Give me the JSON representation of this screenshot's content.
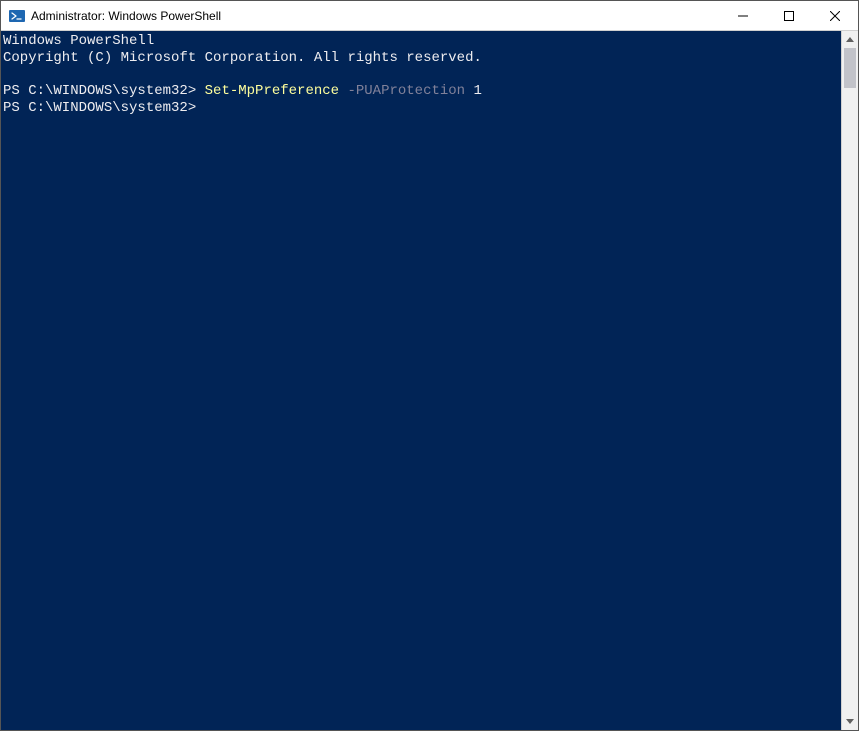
{
  "window": {
    "title": "Administrator: Windows PowerShell"
  },
  "terminal": {
    "header_line1": "Windows PowerShell",
    "header_line2": "Copyright (C) Microsoft Corporation. All rights reserved.",
    "prompt1_prefix": "PS C:\\WINDOWS\\system32> ",
    "prompt1_cmdlet": "Set-MpPreference",
    "prompt1_param": " -PUAProtection",
    "prompt1_value": " 1",
    "prompt2_prefix": "PS C:\\WINDOWS\\system32>"
  },
  "colors": {
    "terminal_bg": "#012456",
    "text_default": "#cccccc",
    "text_white": "#eeedf0",
    "text_yellow": "#fefe9c",
    "text_gray": "#818199"
  }
}
